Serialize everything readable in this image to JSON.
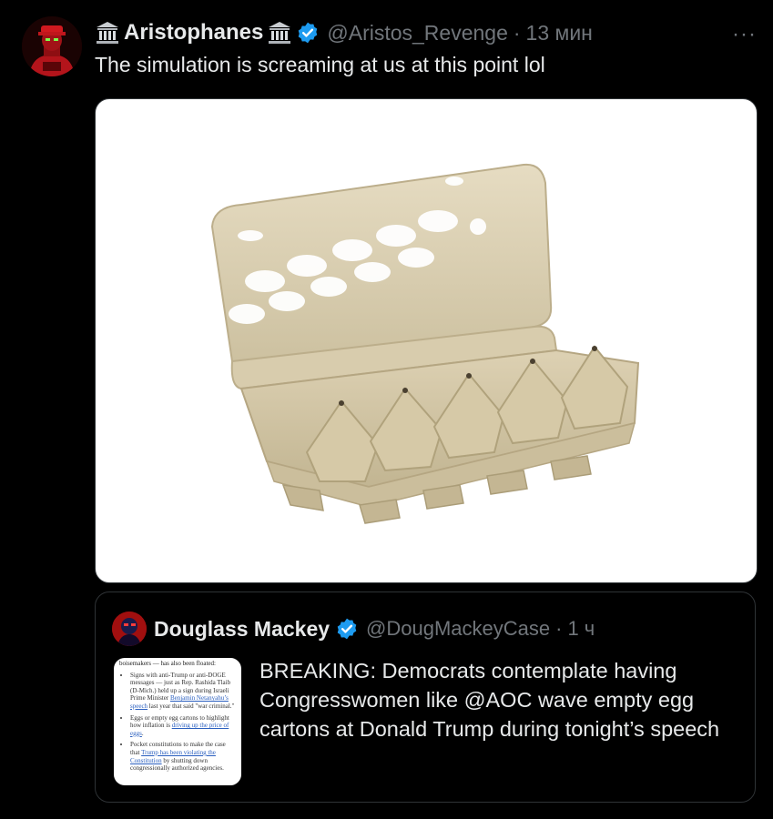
{
  "post": {
    "author_name": "Aristophanes",
    "handle": "@Aristos_Revenge",
    "separator": "·",
    "time": "13 мин",
    "more_label": "···",
    "text": "The simulation is screaming at us at this point lol"
  },
  "quote": {
    "author_name": "Douglass Mackey",
    "handle": "@DougMackeyCase",
    "separator": "·",
    "time": "1 ч",
    "text": "BREAKING: Democrats contemplate having Congresswomen like @AOC wave empty egg cartons at Donald Trump during tonight’s speech",
    "thumbnail": {
      "top_line": "boisemakers — has also been floated:",
      "bullets": [
        {
          "before": "Signs with anti-Trump or anti-DOGE messages — just as Rep. Rashida Tlaib (D-Mich.) held up a sign during Israeli Prime Minister ",
          "link": "Benjamin Netanyahu’s speech",
          "after": " last year that said \"war criminal.\""
        },
        {
          "before": "Eggs or empty egg cartons to highlight how inflation is ",
          "link": "driving up the price of eggs",
          "after": "."
        },
        {
          "before": "Pocket constitutions to make the case that ",
          "link": "Trump has been violating the Constitution",
          "after": " by shutting down congressionally authorized agencies."
        }
      ]
    }
  },
  "colors": {
    "background": "#000000",
    "text_primary": "#e7e9ea",
    "text_secondary": "#71767b",
    "verified_blue": "#1d9bf0",
    "border": "#2f3336"
  },
  "icons": {
    "temple": "classical-building-icon",
    "verified": "verified-badge-icon",
    "more": "more-options-icon"
  }
}
